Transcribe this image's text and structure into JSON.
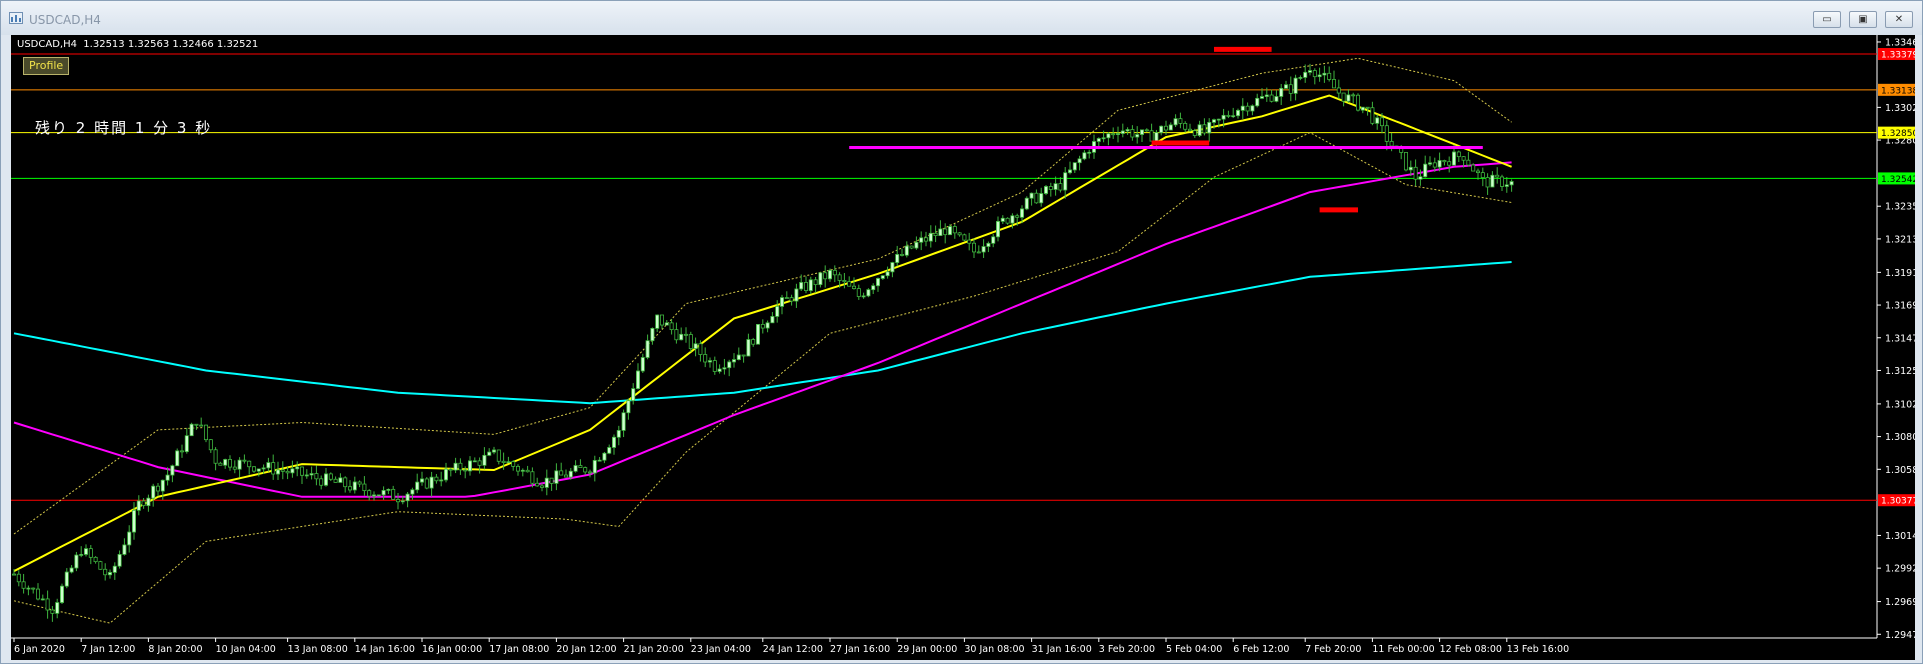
{
  "window": {
    "title": "USDCAD,H4",
    "minimize": "▭",
    "restore": "▣",
    "close": "✕"
  },
  "chart_header": {
    "symbol_line": "USDCAD,H4  1.32513 1.32563 1.32466 1.32521",
    "profile_label": "Profile",
    "countdown": "残り 2 時間 1 分 3 秒"
  },
  "colors": {
    "background": "#000000",
    "bull": "#ccffcc",
    "bear": "#5fc25f",
    "ma_fast": "#ffff00",
    "ma_mid": "#ff00ff",
    "ma_slow": "#00ffff",
    "bands": "#d4c84a",
    "grid_text": "#ffffff"
  },
  "chart_data": {
    "type": "candlestick",
    "symbol": "USDCAD",
    "timeframe": "H4",
    "ohlc_current": {
      "open": 1.32513,
      "high": 1.32563,
      "low": 1.32466,
      "close": 1.32521
    },
    "y_range": [
      1.2945,
      1.3348
    ],
    "y_ticks": [
      "1.33460",
      "1.33020",
      "1.32800",
      "1.32355",
      "1.32135",
      "1.31910",
      "1.31690",
      "1.31470",
      "1.31250",
      "1.31025",
      "1.30805",
      "1.30585",
      "1.30140",
      "1.29920",
      "1.29695",
      "1.29475"
    ],
    "x_labels": [
      "6 Jan 2020",
      "7 Jan 12:00",
      "8 Jan 20:00",
      "10 Jan 04:00",
      "13 Jan 08:00",
      "14 Jan 16:00",
      "16 Jan 00:00",
      "17 Jan 08:00",
      "20 Jan 12:00",
      "21 Jan 20:00",
      "23 Jan 04:00",
      "24 Jan 12:00",
      "27 Jan 16:00",
      "29 Jan 00:00",
      "30 Jan 08:00",
      "31 Jan 16:00",
      "3 Feb 20:00",
      "5 Feb 04:00",
      "6 Feb 12:00",
      "7 Feb 20:00",
      "11 Feb 00:00",
      "12 Feb 08:00",
      "13 Feb 16:00"
    ],
    "price_lines": [
      {
        "price": 1.33379,
        "label": "1.33379",
        "color": "#ff0000"
      },
      {
        "price": 1.33138,
        "label": "1.33138",
        "color": "#ff8c00"
      },
      {
        "price": 1.3285,
        "label": "1.32850",
        "color": "#ffff00"
      },
      {
        "price": 1.32542,
        "label": "1.32542",
        "color": "#00ff00"
      },
      {
        "price": 1.30377,
        "label": "1.30377",
        "color": "#ff0000"
      }
    ],
    "close_anchors": [
      [
        0,
        1.2988
      ],
      [
        8,
        1.2965
      ],
      [
        14,
        1.3005
      ],
      [
        20,
        1.2985
      ],
      [
        26,
        1.3035
      ],
      [
        32,
        1.3055
      ],
      [
        38,
        1.3092
      ],
      [
        42,
        1.3065
      ],
      [
        52,
        1.306
      ],
      [
        60,
        1.3055
      ],
      [
        70,
        1.3047
      ],
      [
        80,
        1.304
      ],
      [
        90,
        1.3056
      ],
      [
        100,
        1.3068
      ],
      [
        110,
        1.305
      ],
      [
        120,
        1.306
      ],
      [
        126,
        1.3085
      ],
      [
        130,
        1.3125
      ],
      [
        134,
        1.316
      ],
      [
        140,
        1.3145
      ],
      [
        146,
        1.3128
      ],
      [
        152,
        1.3138
      ],
      [
        158,
        1.3165
      ],
      [
        164,
        1.318
      ],
      [
        170,
        1.319
      ],
      [
        176,
        1.3175
      ],
      [
        182,
        1.3195
      ],
      [
        188,
        1.321
      ],
      [
        194,
        1.322
      ],
      [
        200,
        1.3205
      ],
      [
        206,
        1.3225
      ],
      [
        212,
        1.324
      ],
      [
        218,
        1.325
      ],
      [
        224,
        1.3275
      ],
      [
        230,
        1.3288
      ],
      [
        236,
        1.3282
      ],
      [
        242,
        1.3292
      ],
      [
        248,
        1.3285
      ],
      [
        254,
        1.33
      ],
      [
        260,
        1.3308
      ],
      [
        266,
        1.3315
      ],
      [
        270,
        1.333
      ],
      [
        276,
        1.3312
      ],
      [
        282,
        1.33
      ],
      [
        288,
        1.3272
      ],
      [
        292,
        1.3255
      ],
      [
        296,
        1.3265
      ],
      [
        302,
        1.327
      ],
      [
        306,
        1.3252
      ],
      [
        312,
        1.3252
      ]
    ],
    "ma_fast": [
      [
        0,
        1.299
      ],
      [
        30,
        1.304
      ],
      [
        60,
        1.3062
      ],
      [
        100,
        1.3058
      ],
      [
        120,
        1.3085
      ],
      [
        150,
        1.316
      ],
      [
        180,
        1.319
      ],
      [
        210,
        1.3225
      ],
      [
        240,
        1.3282
      ],
      [
        260,
        1.3296
      ],
      [
        274,
        1.331
      ],
      [
        290,
        1.329
      ],
      [
        312,
        1.3262
      ]
    ],
    "ma_mid": [
      [
        0,
        1.309
      ],
      [
        30,
        1.306
      ],
      [
        60,
        1.304
      ],
      [
        95,
        1.304
      ],
      [
        120,
        1.3055
      ],
      [
        150,
        1.3095
      ],
      [
        180,
        1.313
      ],
      [
        210,
        1.317
      ],
      [
        240,
        1.321
      ],
      [
        270,
        1.3245
      ],
      [
        300,
        1.3262
      ],
      [
        312,
        1.3265
      ]
    ],
    "ma_slow": [
      [
        0,
        1.315
      ],
      [
        40,
        1.3125
      ],
      [
        80,
        1.311
      ],
      [
        120,
        1.3103
      ],
      [
        150,
        1.311
      ],
      [
        180,
        1.3125
      ],
      [
        210,
        1.315
      ],
      [
        240,
        1.317
      ],
      [
        270,
        1.3188
      ],
      [
        312,
        1.3198
      ]
    ],
    "band_upper": [
      [
        0,
        1.3015
      ],
      [
        30,
        1.3085
      ],
      [
        60,
        1.309
      ],
      [
        100,
        1.3082
      ],
      [
        120,
        1.31
      ],
      [
        140,
        1.317
      ],
      [
        180,
        1.32
      ],
      [
        210,
        1.3245
      ],
      [
        230,
        1.33
      ],
      [
        260,
        1.3325
      ],
      [
        280,
        1.3335
      ],
      [
        300,
        1.332
      ],
      [
        312,
        1.3292
      ]
    ],
    "band_lower": [
      [
        0,
        1.297
      ],
      [
        20,
        1.2955
      ],
      [
        40,
        1.301
      ],
      [
        80,
        1.303
      ],
      [
        115,
        1.3025
      ],
      [
        126,
        1.302
      ],
      [
        140,
        1.307
      ],
      [
        170,
        1.315
      ],
      [
        200,
        1.3175
      ],
      [
        230,
        1.3205
      ],
      [
        250,
        1.3255
      ],
      [
        270,
        1.3285
      ],
      [
        290,
        1.325
      ],
      [
        312,
        1.3238
      ]
    ],
    "annotations": [
      {
        "kind": "hline",
        "price": 1.3275,
        "from": 174,
        "to": 306,
        "color": "#ff00ff"
      },
      {
        "kind": "mark",
        "price": 1.3341,
        "from": 250,
        "to": 262,
        "color": "#ff0000"
      },
      {
        "kind": "mark",
        "price": 1.3278,
        "from": 237,
        "to": 249,
        "color": "#ff0000"
      },
      {
        "kind": "mark",
        "price": 1.3233,
        "from": 272,
        "to": 280,
        "color": "#ff0000"
      }
    ],
    "bar_count": 313
  }
}
